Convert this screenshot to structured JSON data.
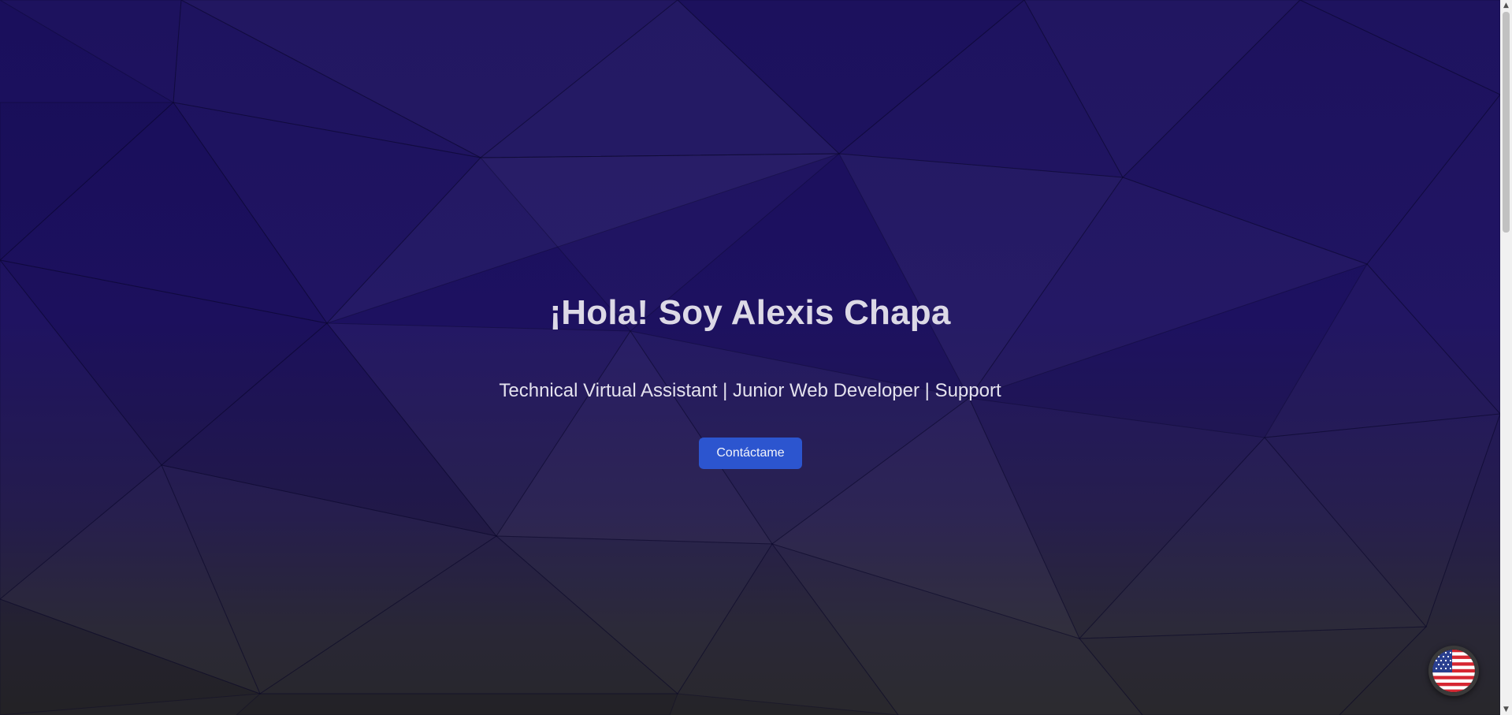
{
  "hero": {
    "title": "¡Hola! Soy Alexis Chapa",
    "subtitle": "Technical Virtual Assistant | Junior Web Developer | Support",
    "cta_label": "Contáctame"
  },
  "language_toggle": {
    "icon": "us-flag-icon"
  },
  "colors": {
    "background_top": "#1a0f5c",
    "background_bottom": "#252428",
    "button": "#2c55cf",
    "text": "#dcd9e6"
  },
  "scrollbar": {
    "up_arrow": "▲",
    "down_arrow": "▼"
  }
}
